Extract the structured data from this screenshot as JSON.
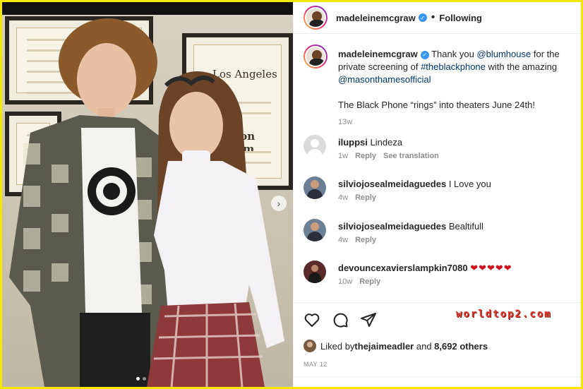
{
  "post": {
    "author": "madeleinemcgraw",
    "follow_label": "Following",
    "caption_parts": {
      "p1": "Thank you ",
      "m1": "@blumhouse",
      "p2": " for the private screening of ",
      "h1": "#theblackphone",
      "p3": " with the amazing ",
      "m2": "@masonthamesofficial",
      "line2": "The Black Phone “rings” into theaters June 24th!"
    },
    "caption_time": "13w"
  },
  "comments": [
    {
      "user": "iluppsi",
      "text": "Lindeza",
      "time": "1w",
      "reply": "Reply",
      "extra": "See translation"
    },
    {
      "user": "silviojosealmeidaguedes",
      "text": "I Love you",
      "time": "4w",
      "reply": "Reply",
      "extra": ""
    },
    {
      "user": "silviojosealmeidaguedes",
      "text": "Bealtifull",
      "time": "4w",
      "reply": "Reply",
      "extra": ""
    },
    {
      "user": "devouncexavierslampkin7080",
      "text": "❤❤❤❤❤",
      "time": "10w",
      "reply": "Reply",
      "extra": ""
    }
  ],
  "likes": {
    "prefix": "Liked by ",
    "user": "thejaimeadler",
    "middle": " and ",
    "count": "8,692 others"
  },
  "date": "MAY 12",
  "watermark": "worldtop2.com",
  "icons": [
    "heart-icon",
    "comment-icon",
    "share-icon"
  ],
  "colors": {
    "frame": "#f5e800",
    "link": "#00376b",
    "verified": "#3897f0",
    "meta": "#8e8e8e"
  },
  "photo_certificate_text": {
    "line1": "Los Angeles",
    "line2": "Jason Blum"
  }
}
